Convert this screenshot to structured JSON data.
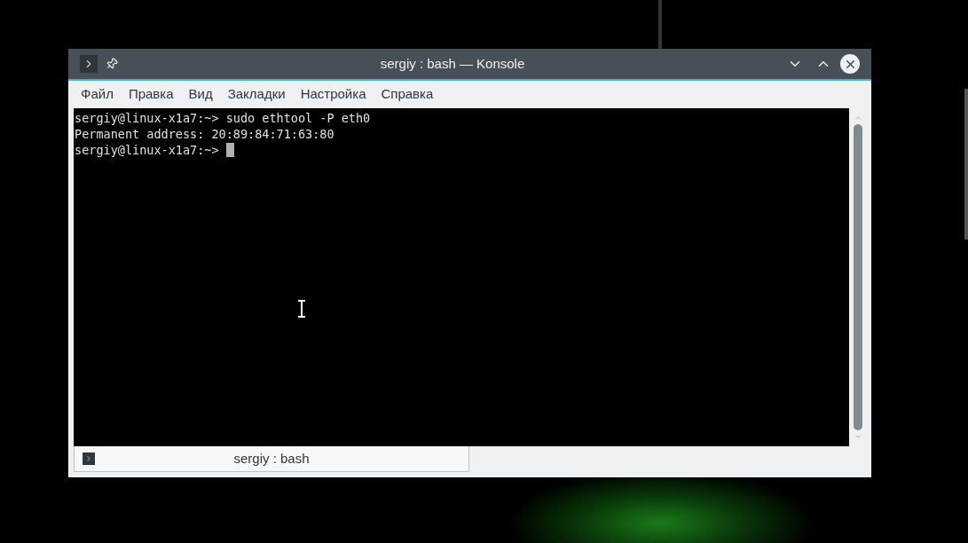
{
  "window": {
    "title": "sergiy : bash — Konsole"
  },
  "menu": [
    "Файл",
    "Правка",
    "Вид",
    "Закладки",
    "Настройка",
    "Справка"
  ],
  "terminal": {
    "lines": [
      "sergiy@linux-x1a7:~> sudo ethtool -P eth0",
      "Permanent address: 20:89:84:71:63:80",
      "sergiy@linux-x1a7:~> "
    ],
    "cursor": true
  },
  "tabs": [
    {
      "label": "sergiy : bash",
      "selected": true
    }
  ]
}
